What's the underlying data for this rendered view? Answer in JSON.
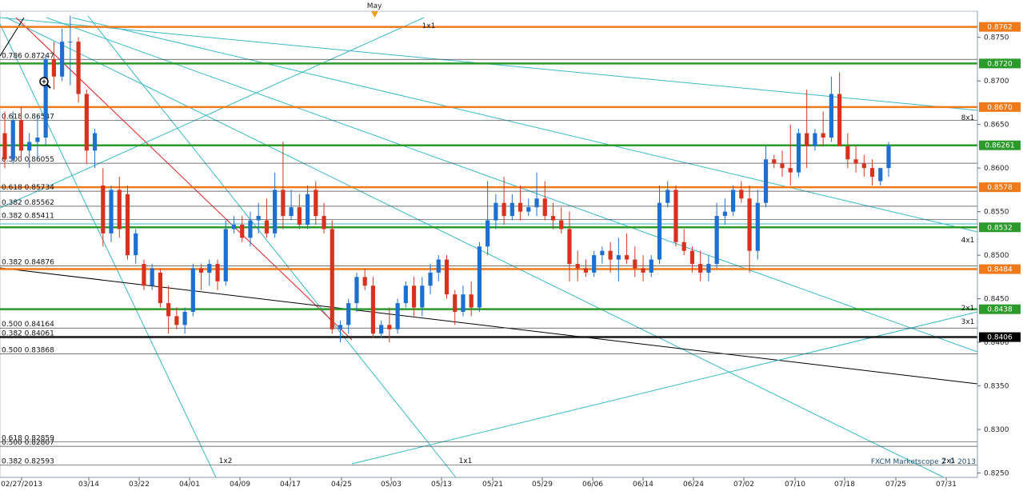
{
  "chart_data": {
    "type": "candlestick",
    "instrument_note": "",
    "watermark": "FXCM Marketscope 2 © 2013",
    "month_marker": "May",
    "x_tick_labels": [
      "02/27/2013",
      "03/14",
      "03/22",
      "04/01",
      "04/09",
      "04/17",
      "04/25",
      "05/03",
      "05/13",
      "05/21",
      "05/29",
      "06/06",
      "06/14",
      "06/24",
      "07/02",
      "07/10",
      "07/18",
      "07/25",
      "07/31"
    ],
    "ylim": [
      0.8245,
      0.878
    ],
    "y_ticks": [
      0.825,
      0.83,
      0.835,
      0.84,
      0.845,
      0.85,
      0.855,
      0.86,
      0.865,
      0.87,
      0.875
    ],
    "y_tick_labels": [
      "0.8250",
      "0.8300",
      "0.8350",
      "0.8400",
      "0.8450",
      "0.8500",
      "0.8550",
      "0.8600",
      "0.8650",
      "0.8700",
      "0.8750"
    ],
    "horizontal_levels": [
      {
        "value": 0.8762,
        "label": "0.8762",
        "color": "#f07a1a"
      },
      {
        "value": 0.872,
        "label": "0.8720",
        "color": "#2a9a2a"
      },
      {
        "value": 0.867,
        "label": "0.8670",
        "color": "#f07a1a"
      },
      {
        "value": 0.86261,
        "label": "0.86261",
        "color": "#2a9a2a"
      },
      {
        "value": 0.8578,
        "label": "0.8578",
        "color": "#f07a1a"
      },
      {
        "value": 0.8532,
        "label": "0.8532",
        "color": "#2a9a2a"
      },
      {
        "value": 0.8484,
        "label": "0.8484",
        "color": "#f07a1a"
      },
      {
        "value": 0.8438,
        "label": "0.8438",
        "color": "#2a9a2a"
      },
      {
        "value": 0.8406,
        "label": "0.8406",
        "color": "#000000"
      }
    ],
    "fib_levels": [
      {
        "value": 0.87247,
        "label": "0.786 0.87247"
      },
      {
        "value": 0.86547,
        "label": "0.618 0.86547"
      },
      {
        "value": 0.86055,
        "label": "0.500 0.86055"
      },
      {
        "value": 0.85734,
        "label": "0.618 0.85734"
      },
      {
        "value": 0.85562,
        "label": "0.382 0.85562"
      },
      {
        "value": 0.85411,
        "label": "0.382 0.85411"
      },
      {
        "value": 0.84876,
        "label": "0.382 0.84876"
      },
      {
        "value": 0.84164,
        "label": "0.500 0.84164"
      },
      {
        "value": 0.84061,
        "label": "0.382 0.84061"
      },
      {
        "value": 0.83868,
        "label": "0.500 0.83868"
      },
      {
        "value": 0.82859,
        "label": "0.618 0.82859"
      },
      {
        "value": 0.82807,
        "label": "0.500 0.82807"
      },
      {
        "value": 0.82593,
        "label": "0.382 0.82593"
      }
    ],
    "gann_labels": [
      "1x1",
      "8x1",
      "4x1",
      "2x1",
      "3x1",
      "1x2",
      "1x1",
      "2x1"
    ],
    "candles": [
      {
        "o": 0.864,
        "h": 0.8665,
        "l": 0.86,
        "c": 0.861
      },
      {
        "o": 0.861,
        "h": 0.8665,
        "l": 0.8605,
        "c": 0.8655
      },
      {
        "o": 0.8655,
        "h": 0.867,
        "l": 0.861,
        "c": 0.862
      },
      {
        "o": 0.862,
        "h": 0.864,
        "l": 0.86,
        "c": 0.863
      },
      {
        "o": 0.863,
        "h": 0.866,
        "l": 0.861,
        "c": 0.8635
      },
      {
        "o": 0.8635,
        "h": 0.873,
        "l": 0.8625,
        "c": 0.8725
      },
      {
        "o": 0.8725,
        "h": 0.8745,
        "l": 0.869,
        "c": 0.8705
      },
      {
        "o": 0.8705,
        "h": 0.876,
        "l": 0.87,
        "c": 0.8745
      },
      {
        "o": 0.8745,
        "h": 0.8775,
        "l": 0.8695,
        "c": 0.8745
      },
      {
        "o": 0.8745,
        "h": 0.875,
        "l": 0.8675,
        "c": 0.8685
      },
      {
        "o": 0.8685,
        "h": 0.869,
        "l": 0.8605,
        "c": 0.862
      },
      {
        "o": 0.862,
        "h": 0.8645,
        "l": 0.86,
        "c": 0.864
      },
      {
        "o": 0.858,
        "h": 0.86,
        "l": 0.851,
        "c": 0.8525
      },
      {
        "o": 0.8525,
        "h": 0.858,
        "l": 0.8515,
        "c": 0.8575
      },
      {
        "o": 0.8575,
        "h": 0.859,
        "l": 0.852,
        "c": 0.853
      },
      {
        "o": 0.857,
        "h": 0.858,
        "l": 0.8495,
        "c": 0.85
      },
      {
        "o": 0.85,
        "h": 0.853,
        "l": 0.849,
        "c": 0.8525
      },
      {
        "o": 0.849,
        "h": 0.8495,
        "l": 0.846,
        "c": 0.8465
      },
      {
        "o": 0.8465,
        "h": 0.849,
        "l": 0.846,
        "c": 0.8485
      },
      {
        "o": 0.848,
        "h": 0.8485,
        "l": 0.844,
        "c": 0.8445
      },
      {
        "o": 0.8445,
        "h": 0.8465,
        "l": 0.841,
        "c": 0.843
      },
      {
        "o": 0.843,
        "h": 0.844,
        "l": 0.8415,
        "c": 0.842
      },
      {
        "o": 0.842,
        "h": 0.844,
        "l": 0.841,
        "c": 0.8435
      },
      {
        "o": 0.8435,
        "h": 0.849,
        "l": 0.843,
        "c": 0.8485
      },
      {
        "o": 0.8485,
        "h": 0.849,
        "l": 0.846,
        "c": 0.848
      },
      {
        "o": 0.848,
        "h": 0.8495,
        "l": 0.8465,
        "c": 0.849
      },
      {
        "o": 0.849,
        "h": 0.8495,
        "l": 0.846,
        "c": 0.847
      },
      {
        "o": 0.847,
        "h": 0.854,
        "l": 0.8465,
        "c": 0.853
      },
      {
        "o": 0.853,
        "h": 0.8545,
        "l": 0.8525,
        "c": 0.8535
      },
      {
        "o": 0.8535,
        "h": 0.8545,
        "l": 0.8515,
        "c": 0.852
      },
      {
        "o": 0.852,
        "h": 0.855,
        "l": 0.851,
        "c": 0.854
      },
      {
        "o": 0.854,
        "h": 0.856,
        "l": 0.8525,
        "c": 0.8545
      },
      {
        "o": 0.854,
        "h": 0.8565,
        "l": 0.852,
        "c": 0.8525
      },
      {
        "o": 0.8525,
        "h": 0.8595,
        "l": 0.852,
        "c": 0.8575
      },
      {
        "o": 0.8575,
        "h": 0.863,
        "l": 0.853,
        "c": 0.8545
      },
      {
        "o": 0.8545,
        "h": 0.8575,
        "l": 0.854,
        "c": 0.8555
      },
      {
        "o": 0.8555,
        "h": 0.857,
        "l": 0.853,
        "c": 0.8535
      },
      {
        "o": 0.8535,
        "h": 0.858,
        "l": 0.853,
        "c": 0.857
      },
      {
        "o": 0.8575,
        "h": 0.8585,
        "l": 0.8535,
        "c": 0.8545
      },
      {
        "o": 0.8545,
        "h": 0.856,
        "l": 0.8525,
        "c": 0.853
      },
      {
        "o": 0.853,
        "h": 0.854,
        "l": 0.841,
        "c": 0.8415
      },
      {
        "o": 0.8415,
        "h": 0.8425,
        "l": 0.84,
        "c": 0.842
      },
      {
        "o": 0.842,
        "h": 0.845,
        "l": 0.841,
        "c": 0.8445
      },
      {
        "o": 0.8445,
        "h": 0.848,
        "l": 0.8435,
        "c": 0.8475
      },
      {
        "o": 0.8475,
        "h": 0.8485,
        "l": 0.846,
        "c": 0.8465
      },
      {
        "o": 0.8465,
        "h": 0.8475,
        "l": 0.8405,
        "c": 0.841
      },
      {
        "o": 0.841,
        "h": 0.8425,
        "l": 0.8405,
        "c": 0.842
      },
      {
        "o": 0.842,
        "h": 0.844,
        "l": 0.84,
        "c": 0.8415
      },
      {
        "o": 0.8415,
        "h": 0.845,
        "l": 0.841,
        "c": 0.8445
      },
      {
        "o": 0.8445,
        "h": 0.847,
        "l": 0.844,
        "c": 0.8465
      },
      {
        "o": 0.8465,
        "h": 0.8475,
        "l": 0.843,
        "c": 0.844
      },
      {
        "o": 0.844,
        "h": 0.8475,
        "l": 0.843,
        "c": 0.8465
      },
      {
        "o": 0.8465,
        "h": 0.849,
        "l": 0.8455,
        "c": 0.848
      },
      {
        "o": 0.848,
        "h": 0.85,
        "l": 0.847,
        "c": 0.8495
      },
      {
        "o": 0.8495,
        "h": 0.85,
        "l": 0.845,
        "c": 0.8455
      },
      {
        "o": 0.8455,
        "h": 0.846,
        "l": 0.842,
        "c": 0.8435
      },
      {
        "o": 0.8435,
        "h": 0.8465,
        "l": 0.843,
        "c": 0.8455
      },
      {
        "o": 0.8455,
        "h": 0.847,
        "l": 0.843,
        "c": 0.844
      },
      {
        "o": 0.844,
        "h": 0.8515,
        "l": 0.8435,
        "c": 0.851
      },
      {
        "o": 0.851,
        "h": 0.8585,
        "l": 0.85,
        "c": 0.854
      },
      {
        "o": 0.854,
        "h": 0.857,
        "l": 0.853,
        "c": 0.856
      },
      {
        "o": 0.856,
        "h": 0.859,
        "l": 0.8535,
        "c": 0.8545
      },
      {
        "o": 0.8545,
        "h": 0.857,
        "l": 0.854,
        "c": 0.856
      },
      {
        "o": 0.856,
        "h": 0.858,
        "l": 0.854,
        "c": 0.855
      },
      {
        "o": 0.855,
        "h": 0.8565,
        "l": 0.8545,
        "c": 0.8555
      },
      {
        "o": 0.8555,
        "h": 0.8595,
        "l": 0.8545,
        "c": 0.8565
      },
      {
        "o": 0.8565,
        "h": 0.8585,
        "l": 0.854,
        "c": 0.8545
      },
      {
        "o": 0.8545,
        "h": 0.856,
        "l": 0.853,
        "c": 0.854
      },
      {
        "o": 0.854,
        "h": 0.8555,
        "l": 0.8525,
        "c": 0.853
      },
      {
        "o": 0.853,
        "h": 0.855,
        "l": 0.847,
        "c": 0.849
      },
      {
        "o": 0.849,
        "h": 0.8505,
        "l": 0.847,
        "c": 0.8485
      },
      {
        "o": 0.8485,
        "h": 0.8495,
        "l": 0.8475,
        "c": 0.848
      },
      {
        "o": 0.848,
        "h": 0.8505,
        "l": 0.8475,
        "c": 0.85
      },
      {
        "o": 0.85,
        "h": 0.851,
        "l": 0.849,
        "c": 0.8505
      },
      {
        "o": 0.8505,
        "h": 0.8515,
        "l": 0.848,
        "c": 0.8495
      },
      {
        "o": 0.8495,
        "h": 0.852,
        "l": 0.847,
        "c": 0.85
      },
      {
        "o": 0.85,
        "h": 0.8525,
        "l": 0.849,
        "c": 0.8495
      },
      {
        "o": 0.8495,
        "h": 0.851,
        "l": 0.8475,
        "c": 0.8485
      },
      {
        "o": 0.8485,
        "h": 0.85,
        "l": 0.847,
        "c": 0.848
      },
      {
        "o": 0.848,
        "h": 0.85,
        "l": 0.8475,
        "c": 0.8495
      },
      {
        "o": 0.8495,
        "h": 0.858,
        "l": 0.849,
        "c": 0.856
      },
      {
        "o": 0.856,
        "h": 0.8585,
        "l": 0.8555,
        "c": 0.8575
      },
      {
        "o": 0.8575,
        "h": 0.858,
        "l": 0.851,
        "c": 0.8515
      },
      {
        "o": 0.8515,
        "h": 0.853,
        "l": 0.85,
        "c": 0.8505
      },
      {
        "o": 0.8505,
        "h": 0.851,
        "l": 0.848,
        "c": 0.849
      },
      {
        "o": 0.849,
        "h": 0.8505,
        "l": 0.847,
        "c": 0.848
      },
      {
        "o": 0.848,
        "h": 0.85,
        "l": 0.847,
        "c": 0.849
      },
      {
        "o": 0.849,
        "h": 0.856,
        "l": 0.8485,
        "c": 0.8545
      },
      {
        "o": 0.8545,
        "h": 0.8565,
        "l": 0.8535,
        "c": 0.855
      },
      {
        "o": 0.855,
        "h": 0.858,
        "l": 0.8545,
        "c": 0.8575
      },
      {
        "o": 0.8575,
        "h": 0.8585,
        "l": 0.856,
        "c": 0.8565
      },
      {
        "o": 0.8565,
        "h": 0.858,
        "l": 0.848,
        "c": 0.8505
      },
      {
        "o": 0.8505,
        "h": 0.8575,
        "l": 0.8495,
        "c": 0.856
      },
      {
        "o": 0.856,
        "h": 0.8625,
        "l": 0.8555,
        "c": 0.861
      },
      {
        "o": 0.861,
        "h": 0.8615,
        "l": 0.86,
        "c": 0.8605
      },
      {
        "o": 0.8605,
        "h": 0.862,
        "l": 0.859,
        "c": 0.86
      },
      {
        "o": 0.86,
        "h": 0.865,
        "l": 0.858,
        "c": 0.8595
      },
      {
        "o": 0.8595,
        "h": 0.8645,
        "l": 0.859,
        "c": 0.864
      },
      {
        "o": 0.864,
        "h": 0.869,
        "l": 0.86,
        "c": 0.8625
      },
      {
        "o": 0.8625,
        "h": 0.8645,
        "l": 0.862,
        "c": 0.864
      },
      {
        "o": 0.864,
        "h": 0.8665,
        "l": 0.8625,
        "c": 0.8635
      },
      {
        "o": 0.8635,
        "h": 0.8705,
        "l": 0.863,
        "c": 0.8685
      },
      {
        "o": 0.8685,
        "h": 0.871,
        "l": 0.864,
        "c": 0.8625
      },
      {
        "o": 0.8625,
        "h": 0.864,
        "l": 0.86,
        "c": 0.861
      },
      {
        "o": 0.861,
        "h": 0.8625,
        "l": 0.8595,
        "c": 0.8605
      },
      {
        "o": 0.8605,
        "h": 0.8615,
        "l": 0.859,
        "c": 0.86
      },
      {
        "o": 0.86,
        "h": 0.861,
        "l": 0.858,
        "c": 0.859
      },
      {
        "o": 0.8585,
        "h": 0.86,
        "l": 0.858,
        "c": 0.86
      },
      {
        "o": 0.86,
        "h": 0.863,
        "l": 0.859,
        "c": 0.8626
      }
    ]
  }
}
